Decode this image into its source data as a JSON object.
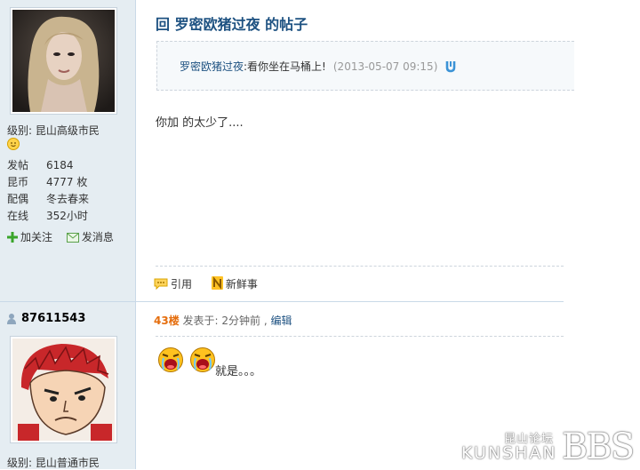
{
  "post1": {
    "user": {
      "level_label": "级别: 昆山高级市民",
      "stats": [
        {
          "label": "发帖",
          "value": "6184"
        },
        {
          "label": "昆币",
          "value": "4777 枚"
        },
        {
          "label": "配偶",
          "value": "冬去春来"
        },
        {
          "label": "在线",
          "value": "352小时"
        }
      ],
      "follow_label": "加关注",
      "message_label": "发消息"
    },
    "title": "回 罗密欧猪过夜 的帖子",
    "quote": {
      "author": "罗密欧猪过夜",
      "text": ":看你坐在马桶上!",
      "time": "(2013-05-07 09:15)"
    },
    "body": "你加 的太少了....",
    "footer": {
      "quote_label": "引用",
      "fresh_label": "新鲜事"
    }
  },
  "post2": {
    "user": {
      "username": "87611543",
      "level_label": "级别: 昆山普通市民"
    },
    "floor": "43楼",
    "posted_at": "发表于: 2分钟前 ,",
    "edit_label": "编辑",
    "body": "就是。。。"
  },
  "watermark": {
    "cn": "昆山论坛",
    "en": "KUNSHAN",
    "bbs": "BBS"
  }
}
